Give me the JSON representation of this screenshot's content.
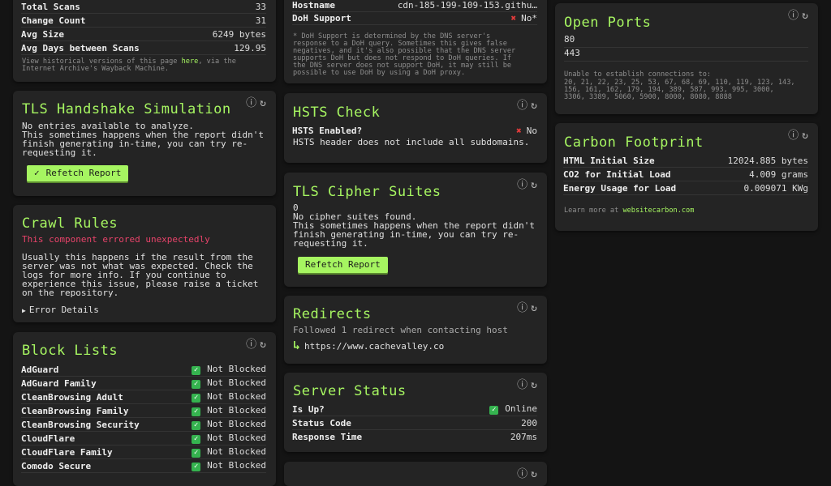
{
  "history": {
    "rows": [
      {
        "k": "Total Scans",
        "v": "33"
      },
      {
        "k": "Change Count",
        "v": "31"
      },
      {
        "k": "Avg Size",
        "v": "6249 bytes"
      },
      {
        "k": "Avg Days between Scans",
        "v": "129.95"
      }
    ],
    "note_pre": "View historical versions of this page ",
    "note_link": "here",
    "note_post": ", via the\nInternet Archive's Wayback Machine."
  },
  "tls_handshake": {
    "title": "TLS Handshake Simulation",
    "body": "No entries available to analyze.\nThis sometimes happens when the report didn't\nfinish generating in-time, you can try re-\nrequesting it.",
    "button": "Refetch Report",
    "button_icon": "✓"
  },
  "crawl_rules": {
    "title": "Crawl Rules",
    "error": "This component errored unexpectedly",
    "body": "Usually this happens if the result from the\nserver was not what was expected. Check the\nlogs for more info. If you continue to\nexperience this issue, please raise a ticket\non the repository.",
    "details": "Error Details"
  },
  "block_lists": {
    "title": "Block Lists",
    "rows": [
      {
        "k": "AdGuard",
        "v": "Not Blocked"
      },
      {
        "k": "AdGuard Family",
        "v": "Not Blocked"
      },
      {
        "k": "CleanBrowsing Adult",
        "v": "Not Blocked"
      },
      {
        "k": "CleanBrowsing Family",
        "v": "Not Blocked"
      },
      {
        "k": "CleanBrowsing Security",
        "v": "Not Blocked"
      },
      {
        "k": "CloudFlare",
        "v": "Not Blocked"
      },
      {
        "k": "CloudFlare Family",
        "v": "Not Blocked"
      },
      {
        "k": "Comodo Secure",
        "v": "Not Blocked"
      }
    ]
  },
  "dns": {
    "hostname_k": "Hostname",
    "hostname_v": "cdn-185-199-109-153.githu…",
    "doh_k": "DoH Support",
    "doh_v": "No*",
    "note": "* DoH Support is determined by the DNS server's\nresponse to a DoH query. Sometimes this gives false\nnegatives, and it's also possible that the DNS server\nsupports DoH but does not respond to DoH queries. If\nthe DNS server does not support DoH, it may still be\npossible to use DoH by using a DoH proxy."
  },
  "hsts": {
    "title": "HSTS Check",
    "k": "HSTS Enabled?",
    "v": "No",
    "body": "HSTS header does not include all subdomains."
  },
  "cipher": {
    "title": "TLS Cipher Suites",
    "body": "0\nNo cipher suites found.\nThis sometimes happens when the report didn't\nfinish generating in-time, you can try re-\nrequesting it.",
    "button": "Refetch Report"
  },
  "redirects": {
    "title": "Redirects",
    "body": "Followed 1 redirect when contacting host",
    "url": "https://www.cachevalley.co"
  },
  "server_status": {
    "title": "Server Status",
    "rows": [
      {
        "k": "Is Up?",
        "v": "Online"
      },
      {
        "k": "Status Code",
        "v": "200"
      },
      {
        "k": "Response Time",
        "v": "207ms"
      }
    ]
  },
  "open_ports": {
    "title": "Open Ports",
    "ports": [
      "80",
      "443"
    ],
    "closed_label": "Unable to establish connections to:",
    "closed": "20, 21, 22, 23, 25, 53, 67, 68, 69, 110, 119, 123, 143,\n156, 161, 162, 179, 194, 389, 587, 993, 995, 3000,\n3306, 3389, 5060, 5900, 8000, 8080, 8888"
  },
  "carbon": {
    "title": "Carbon Footprint",
    "rows": [
      {
        "k": "HTML Initial Size",
        "v": "12024.885 bytes"
      },
      {
        "k": "CO2 for Initial Load",
        "v": "4.009 grams"
      },
      {
        "k": "Energy Usage for Load",
        "v": "0.009071 KWg"
      }
    ],
    "learn_pre": "Learn more at ",
    "learn_link": "websitecarbon.com"
  },
  "icons": {
    "info": "ⓘ",
    "refresh": "↻",
    "check": "✓",
    "cross": "✖",
    "arrow": "↳",
    "triangle": "▶"
  },
  "colors": {
    "accent": "#a6f561",
    "error": "#e23b3b",
    "ok": "#33c15b",
    "bg": "#141414",
    "card": "#242424"
  }
}
